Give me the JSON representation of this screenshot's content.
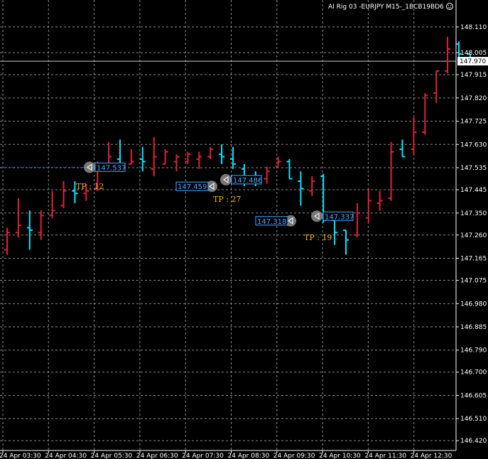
{
  "title": "AI Rig 03 -EURJPY M15-_1BCB19BD6",
  "smiley_icon": "smiley-icon",
  "colors": {
    "bg": "#000000",
    "grid": "#8a8a8a",
    "bull": "#00e5ff",
    "bear": "#e0203a",
    "text": "#ffffff",
    "tp": "#f5b800",
    "trade_line": "#2255ff",
    "current": "#cccccc"
  },
  "chart_data": {
    "type": "bar",
    "symbol": "EURJPY",
    "timeframe": "M15",
    "ylim": [
      146.38,
      148.22
    ],
    "y_ticks": [
      "148.110",
      "148.005",
      "147.915",
      "147.820",
      "147.725",
      "147.630",
      "147.535",
      "147.445",
      "147.350",
      "147.260",
      "147.165",
      "147.075",
      "146.980",
      "146.885",
      "146.790",
      "146.700",
      "146.605",
      "146.510",
      "146.420"
    ],
    "x_ticks": [
      "24 Apr 03:30",
      "24 Apr 04:30",
      "24 Apr 05:30",
      "24 Apr 06:30",
      "24 Apr 07:30",
      "24 Apr 08:30",
      "24 Apr 09:30",
      "24 Apr 10:30",
      "24 Apr 11:30",
      "24 Apr 12:30"
    ],
    "current_price": "147.970",
    "bars": [
      {
        "o": 147.2,
        "h": 147.29,
        "l": 147.18,
        "c": 147.27
      },
      {
        "o": 147.27,
        "h": 147.41,
        "l": 147.25,
        "c": 147.3
      },
      {
        "o": 147.29,
        "h": 147.36,
        "l": 147.2,
        "c": 147.28
      },
      {
        "o": 147.27,
        "h": 147.36,
        "l": 147.24,
        "c": 147.34
      },
      {
        "o": 147.34,
        "h": 147.44,
        "l": 147.33,
        "c": 147.36
      },
      {
        "o": 147.38,
        "h": 147.48,
        "l": 147.37,
        "c": 147.44
      },
      {
        "o": 147.44,
        "h": 147.48,
        "l": 147.39,
        "c": 147.43
      },
      {
        "o": 147.43,
        "h": 147.47,
        "l": 147.4,
        "c": 147.44
      },
      {
        "o": 147.45,
        "h": 147.56,
        "l": 147.44,
        "c": 147.55
      },
      {
        "o": 147.55,
        "h": 147.64,
        "l": 147.53,
        "c": 147.58
      },
      {
        "o": 147.57,
        "h": 147.65,
        "l": 147.53,
        "c": 147.55
      },
      {
        "o": 147.55,
        "h": 147.61,
        "l": 147.55,
        "c": 147.56
      },
      {
        "o": 147.57,
        "h": 147.62,
        "l": 147.52,
        "c": 147.56
      },
      {
        "o": 147.53,
        "h": 147.66,
        "l": 147.5,
        "c": 147.58
      },
      {
        "o": 147.55,
        "h": 147.61,
        "l": 147.55,
        "c": 147.6
      },
      {
        "o": 147.56,
        "h": 147.59,
        "l": 147.52,
        "c": 147.58
      },
      {
        "o": 147.56,
        "h": 147.6,
        "l": 147.55,
        "c": 147.59
      },
      {
        "o": 147.57,
        "h": 147.6,
        "l": 147.53,
        "c": 147.58
      },
      {
        "o": 147.58,
        "h": 147.62,
        "l": 147.57,
        "c": 147.61
      },
      {
        "o": 147.59,
        "h": 147.63,
        "l": 147.55,
        "c": 147.58
      },
      {
        "o": 147.57,
        "h": 147.62,
        "l": 147.53,
        "c": 147.55
      },
      {
        "o": 147.53,
        "h": 147.55,
        "l": 147.46,
        "c": 147.48
      },
      {
        "o": 147.49,
        "h": 147.52,
        "l": 147.46,
        "c": 147.47
      },
      {
        "o": 147.49,
        "h": 147.54,
        "l": 147.47,
        "c": 147.52
      },
      {
        "o": 147.54,
        "h": 147.58,
        "l": 147.54,
        "c": 147.56
      },
      {
        "o": 147.56,
        "h": 147.57,
        "l": 147.49,
        "c": 147.49
      },
      {
        "o": 147.48,
        "h": 147.52,
        "l": 147.38,
        "c": 147.45
      },
      {
        "o": 147.44,
        "h": 147.5,
        "l": 147.42,
        "c": 147.48
      },
      {
        "o": 147.5,
        "h": 147.51,
        "l": 147.31,
        "c": 147.32
      },
      {
        "o": 147.32,
        "h": 147.35,
        "l": 147.22,
        "c": 147.27
      },
      {
        "o": 147.28,
        "h": 147.28,
        "l": 147.18,
        "c": 147.24
      },
      {
        "o": 147.26,
        "h": 147.39,
        "l": 147.25,
        "c": 147.35
      },
      {
        "o": 147.33,
        "h": 147.45,
        "l": 147.31,
        "c": 147.4
      },
      {
        "o": 147.39,
        "h": 147.44,
        "l": 147.36,
        "c": 147.4
      },
      {
        "o": 147.41,
        "h": 147.64,
        "l": 147.4,
        "c": 147.6
      },
      {
        "o": 147.61,
        "h": 147.65,
        "l": 147.58,
        "c": 147.58
      },
      {
        "o": 147.61,
        "h": 147.74,
        "l": 147.59,
        "c": 147.68
      },
      {
        "o": 147.68,
        "h": 147.84,
        "l": 147.67,
        "c": 147.83
      },
      {
        "o": 147.84,
        "h": 147.93,
        "l": 147.8,
        "c": 147.93
      },
      {
        "o": 147.93,
        "h": 148.07,
        "l": 147.92,
        "c": 148.02
      },
      {
        "o": 148.04,
        "h": 148.05,
        "l": 147.97,
        "c": 148.0
      },
      {
        "o": 148.0,
        "h": 148.0,
        "l": 147.96,
        "c": 147.98
      }
    ],
    "trades": [
      {
        "label": "147.537",
        "price": 147.537,
        "tp": "TP : 12"
      },
      {
        "label": "147.459",
        "price": 147.459,
        "tp": "TP : 27"
      },
      {
        "label": "147.486",
        "price": 147.486,
        "tp": ""
      },
      {
        "label": "147.318",
        "price": 147.318,
        "tp": "TP : 19"
      },
      {
        "label": "147.337",
        "price": 147.337,
        "tp": ""
      }
    ]
  }
}
